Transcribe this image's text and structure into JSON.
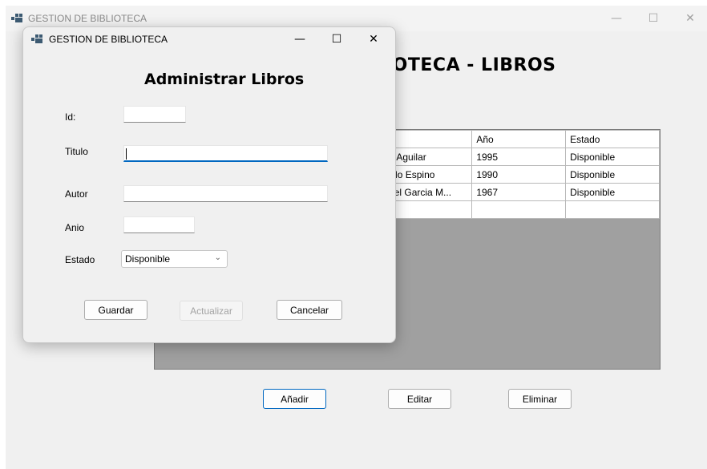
{
  "main_window": {
    "title": "GESTION DE BIBLIOTECA",
    "header": "IOTECA - LIBROS",
    "caption_buttons": {
      "minimize": "—",
      "maximize": "☐",
      "close": "✕"
    },
    "table": {
      "columns": [
        "",
        "tor",
        "Año",
        "Estado"
      ],
      "rows": [
        [
          "",
          "ria Aguilar",
          "1995",
          "Disponible"
        ],
        [
          "",
          "redo Espino",
          "1990",
          "Disponible"
        ],
        [
          "",
          "briel Garcia M...",
          "1967",
          "Disponible"
        ],
        [
          "",
          "",
          "",
          ""
        ]
      ]
    },
    "buttons": {
      "add": "Añadir",
      "edit": "Editar",
      "delete": "Eliminar"
    }
  },
  "dialog": {
    "title": "GESTION DE BIBLIOTECA",
    "heading": "Administrar Libros",
    "caption_buttons": {
      "minimize": "—",
      "maximize": "☐",
      "close": "✕"
    },
    "fields": {
      "id": {
        "label": "Id:",
        "value": ""
      },
      "titulo": {
        "label": "Titulo",
        "value": ""
      },
      "autor": {
        "label": "Autor",
        "value": ""
      },
      "anio": {
        "label": "Anio",
        "value": ""
      },
      "estado": {
        "label": "Estado",
        "value": "Disponible"
      }
    },
    "buttons": {
      "save": "Guardar",
      "update": "Actualizar",
      "cancel": "Cancelar"
    }
  },
  "colors": {
    "accent": "#0067c0",
    "grid_background": "#a0a0a0",
    "window_bg": "#f0f0f0"
  },
  "icons": {
    "app": "app-grid-icon",
    "dropdown": "chevron-down-icon"
  }
}
